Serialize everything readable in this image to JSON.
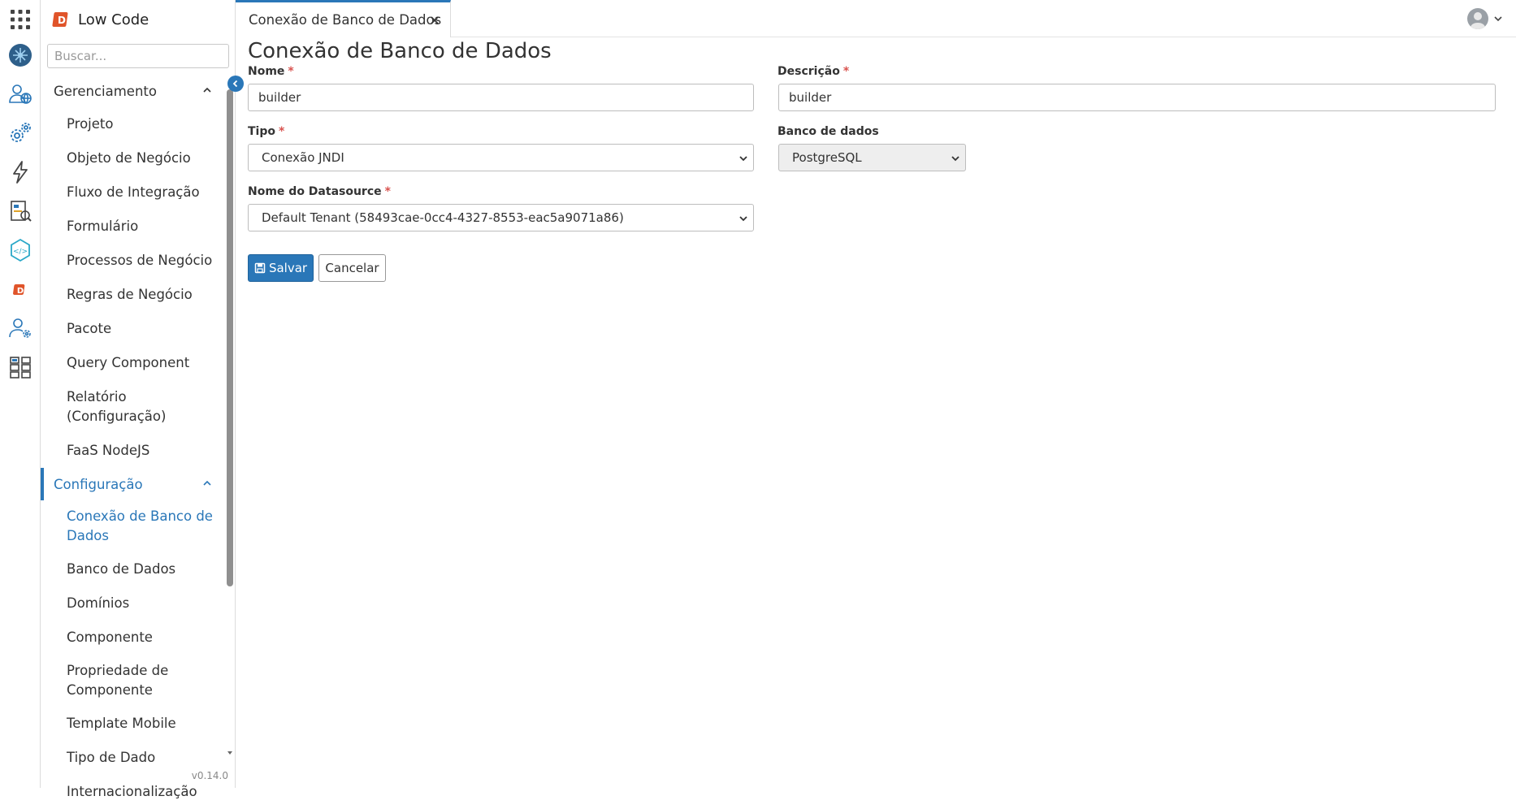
{
  "app": {
    "title": "Low Code",
    "version": "v0.14.0"
  },
  "rail": {
    "icons": [
      "apps-grid-icon",
      "globe-network-icon",
      "users-globe-icon",
      "gears-icon",
      "lightning-icon",
      "report-search-icon",
      "code-hexagon-icon",
      "brand-d-icon",
      "user-settings-icon",
      "hierarchy-icon"
    ]
  },
  "sidebar": {
    "search_placeholder": "Buscar...",
    "groups": [
      {
        "label": "Gerenciamento",
        "items": [
          "Projeto",
          "Objeto de Negócio",
          "Fluxo de Integração",
          "Formulário",
          "Processos de Negócio",
          "Regras de Negócio",
          "Pacote",
          "Query Component",
          "Relatório (Configuração)",
          "FaaS NodeJS"
        ]
      },
      {
        "label": "Configuração",
        "items": [
          "Conexão de Banco de Dados",
          "Banco de Dados",
          "Domínios",
          "Componente",
          "Propriedade de Componente",
          "Template Mobile",
          "Tipo de Dado",
          "Internacionalização"
        ]
      }
    ]
  },
  "tabs": [
    {
      "label": "Conexão de Banco de Dados"
    }
  ],
  "form": {
    "title": "Conexão de Banco de Dados",
    "required_mark": "*",
    "nome": {
      "label": "Nome",
      "value": "builder"
    },
    "descricao": {
      "label": "Descrição",
      "value": "builder"
    },
    "tipo": {
      "label": "Tipo",
      "value": "Conexão JNDI"
    },
    "banco": {
      "label": "Banco de dados",
      "value": "PostgreSQL"
    },
    "datasource": {
      "label": "Nome do Datasource",
      "value": "Default Tenant (58493cae-0cc4-4327-8553-eac5a9071a86)"
    },
    "save_label": "Salvar",
    "cancel_label": "Cancelar"
  },
  "colors": {
    "accent": "#2a77b8",
    "required": "#d9534f",
    "brand": "#e0542a"
  }
}
